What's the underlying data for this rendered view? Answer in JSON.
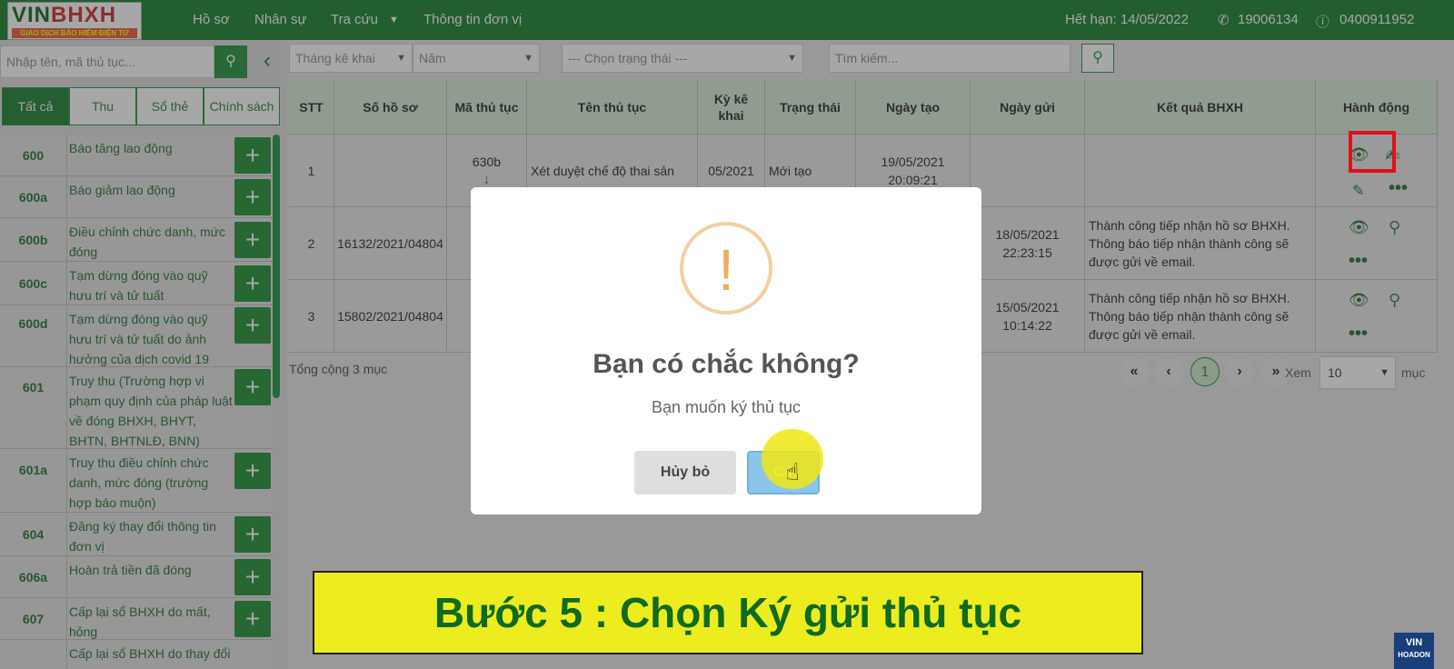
{
  "topbar": {
    "logo_main": "VIN",
    "logo_red": "BHXH",
    "logo_sub": "GIAO DỊCH BẢO HIỂM ĐIỆN TỬ",
    "menu": [
      "Hồ sơ",
      "Nhân sự",
      "Tra cứu",
      "Thông tin đơn vị"
    ],
    "expiry": "Hết hạn: 14/05/2022",
    "phone": "19006134",
    "taxcode": "0400911952"
  },
  "sidebar": {
    "search_placeholder": "Nhập tên, mã thủ tục...",
    "tabs": [
      "Tất cả",
      "Thu",
      "Sổ thẻ",
      "Chính sách"
    ],
    "procedures": [
      {
        "code": "600",
        "name": "Báo tăng lao động"
      },
      {
        "code": "600a",
        "name": "Báo giảm lao động"
      },
      {
        "code": "600b",
        "name": "Điều chỉnh chức danh, mức đóng"
      },
      {
        "code": "600c",
        "name": "Tạm dừng đóng vào quỹ hưu trí và tử tuất"
      },
      {
        "code": "600d",
        "name": "Tạm dừng đóng vào quỹ hưu trí và tử tuất do ảnh hưởng của dịch covid 19"
      },
      {
        "code": "601",
        "name": "Truy thu (Trường hợp vi phạm quy định của pháp luật về đóng BHXH, BHYT, BHTN, BHTNLĐ, BNN)"
      },
      {
        "code": "601a",
        "name": "Truy thu điều chỉnh chức danh, mức đóng (trường hợp báo muộn)"
      },
      {
        "code": "604",
        "name": "Đăng ký thay đổi thông tin đơn vị"
      },
      {
        "code": "606a",
        "name": "Hoàn trả tiền đã đóng"
      },
      {
        "code": "607",
        "name": "Cấp lại sổ BHXH do mất, hỏng"
      },
      {
        "code": "",
        "name": "Cấp lại sổ BHXH do thay đổi họ"
      }
    ]
  },
  "filters": {
    "month": "Tháng kê khai",
    "year": "Năm",
    "status": "--- Chọn trạng thái ---",
    "search": "Tìm kiếm..."
  },
  "table": {
    "headers": [
      "STT",
      "Số hồ sơ",
      "Mã thủ tục",
      "Tên thủ tục",
      "Kỳ kê khai",
      "Trạng thái",
      "Ngày tạo",
      "Ngày gửi",
      "Kết quả BHXH",
      "Hành động"
    ],
    "rows": [
      {
        "stt": "1",
        "so_ho_so": "",
        "ma": "630b",
        "ten": "Xét duyệt chế độ thai sản",
        "ky": "05/2021",
        "trang_thai": "Mới tạo",
        "ngay_tao": "19/05/2021 20:09:21",
        "ngay_gui": "",
        "ket_qua": ""
      },
      {
        "stt": "2",
        "so_ho_so": "16132/2021/04804",
        "ma": "",
        "ten": "",
        "ky": "",
        "trang_thai": "",
        "ngay_tao": "",
        "ngay_gui": "18/05/2021 22:23:15",
        "ket_qua": "Thành công tiếp nhận hồ sơ BHXH. Thông báo tiếp nhận thành công sẽ được gửi về email."
      },
      {
        "stt": "3",
        "so_ho_so": "15802/2021/04804",
        "ma": "",
        "ten": "",
        "ky": "",
        "trang_thai": "",
        "ngay_tao": "",
        "ngay_gui": "15/05/2021 10:14:22",
        "ket_qua": "Thành công tiếp nhận hồ sơ BHXH. Thông báo tiếp nhận thành công sẽ được gửi về email."
      }
    ],
    "total": "Tổng cộng 3 mục"
  },
  "pagination": {
    "current": "1",
    "xem": "Xem",
    "per_page": "10",
    "muc": "mục"
  },
  "dialog": {
    "title": "Bạn có chắc không?",
    "text": "Bạn muốn ký thủ tục",
    "cancel": "Hủy bỏ",
    "ok": "Có"
  },
  "banner": {
    "text": "Bước 5 : Chọn Ký gửi thủ tục"
  },
  "watermark": {
    "brand_top": "VIN",
    "brand_bottom": "HOADON"
  },
  "colors": {
    "brand_green": "#0d7a24",
    "banner_yellow": "#ecec1f",
    "highlight_red": "#e0101a"
  }
}
